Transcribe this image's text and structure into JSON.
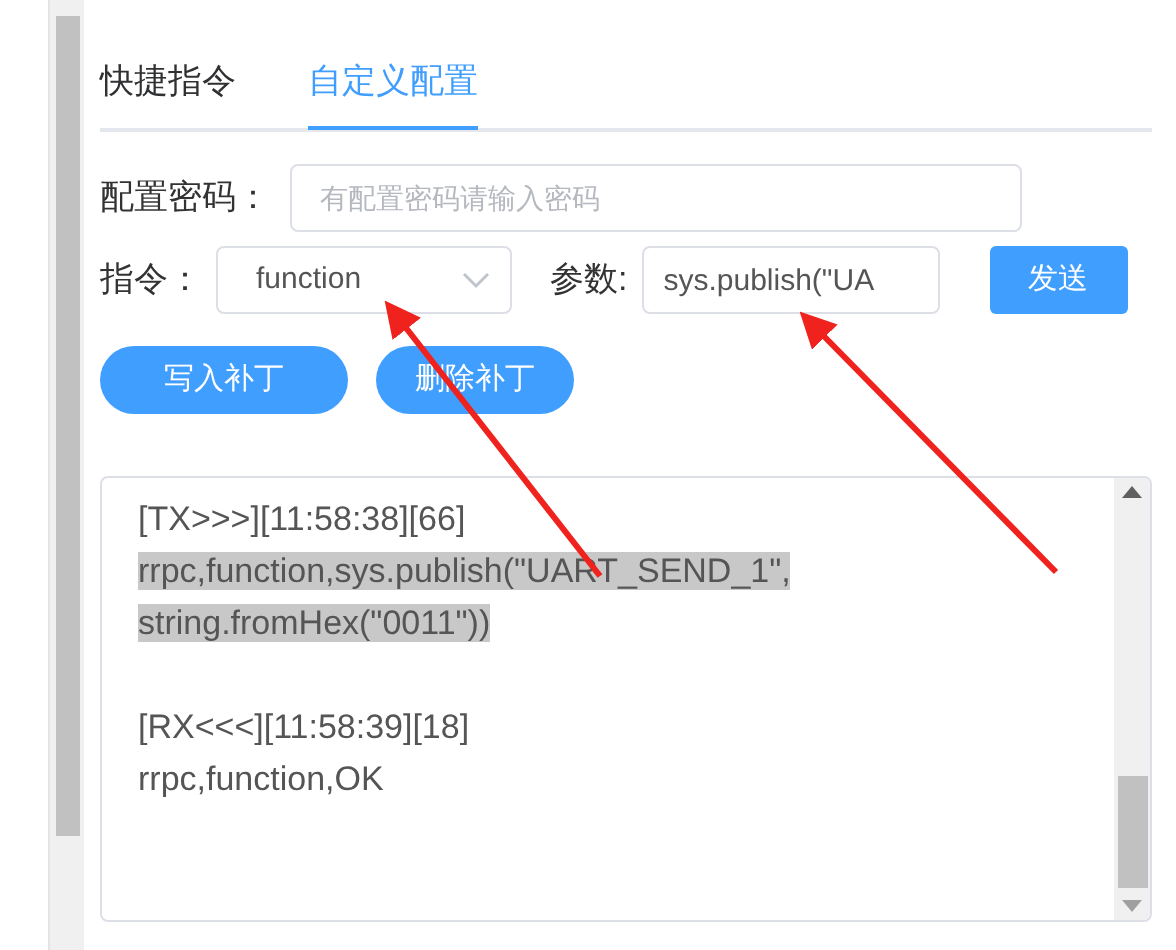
{
  "tabs": [
    {
      "label": "快捷指令",
      "selected": false
    },
    {
      "label": "自定义配置",
      "selected": true
    }
  ],
  "password": {
    "label": "配置密码：",
    "placeholder": "有配置密码请输入密码"
  },
  "command": {
    "label": "指令：",
    "value": "function"
  },
  "params": {
    "label": "参数:",
    "value": "sys.publish(\"UA"
  },
  "send_button": "发送",
  "patch_buttons": [
    "写入补丁",
    "删除补丁"
  ],
  "log": [
    {
      "header": "[TX>>>][11:58:38][66]",
      "lines": [
        "rrpc,function,sys.publish(\"UART_SEND_1\",",
        "string.fromHex(\"0011\"))"
      ],
      "highlighted": true
    },
    {
      "header": "[RX<<<][11:58:39][18]",
      "lines": [
        "rrpc,function,OK"
      ],
      "highlighted": false
    }
  ]
}
